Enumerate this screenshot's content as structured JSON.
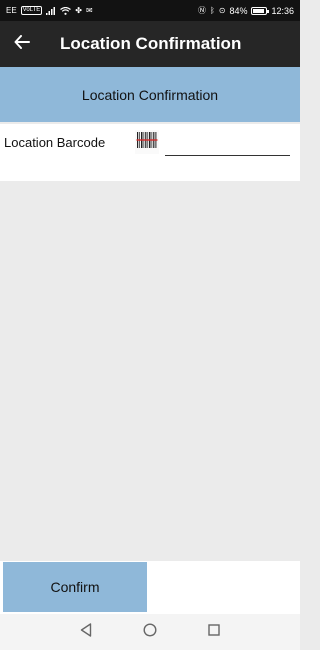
{
  "status_bar": {
    "carrier": "EE",
    "volte": "VoLTE",
    "battery_percent": "84%",
    "battery_level": 0.84,
    "time": "12:36",
    "icons": [
      "signal-icon",
      "wifi-icon",
      "fan-icon",
      "mail-icon",
      "nfc-icon",
      "bluetooth-icon",
      "location-icon",
      "battery-icon"
    ]
  },
  "app_bar": {
    "back_icon": "arrow-left-icon",
    "title": "Location Confirmation"
  },
  "section_header": {
    "title": "Location Confirmation"
  },
  "form": {
    "field_label": "Location Barcode",
    "scan_icon": "barcode-icon",
    "barcode_value": "",
    "barcode_placeholder": ""
  },
  "footer": {
    "confirm_label": "Confirm"
  },
  "nav_bar": {
    "buttons": [
      "back-triangle-icon",
      "home-circle-icon",
      "recents-square-icon"
    ]
  },
  "colors": {
    "accent": "#8fb8d9",
    "app_bar": "#262626",
    "background": "#ebebeb"
  }
}
